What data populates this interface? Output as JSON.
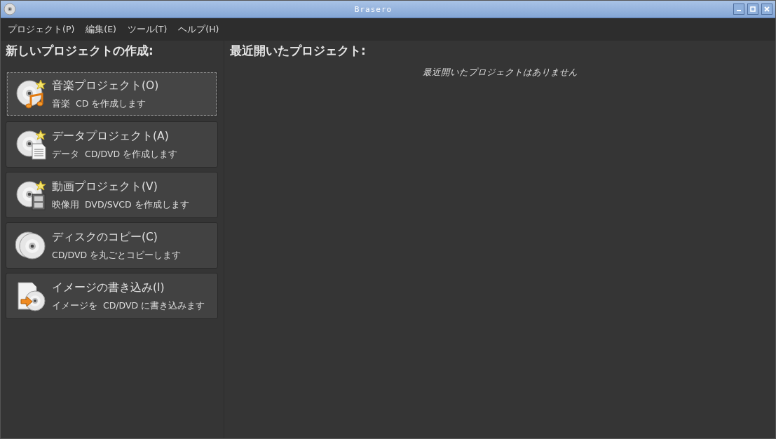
{
  "window": {
    "title": "Brasero"
  },
  "menu": [
    "プロジェクト(P)",
    "編集(E)",
    "ツール(T)",
    "ヘルプ(H)"
  ],
  "new_project": {
    "heading": "新しいプロジェクトの作成:",
    "items": [
      {
        "kind": "audio",
        "title": "音楽プロジェクト(O)",
        "description": "音楽  CD を作成します",
        "selected": true
      },
      {
        "kind": "data",
        "title": "データプロジェクト(A)",
        "description": "データ  CD/DVD を作成します",
        "selected": false
      },
      {
        "kind": "video",
        "title": "動画プロジェクト(V)",
        "description": "映像用  DVD/SVCD を作成します",
        "selected": false
      },
      {
        "kind": "copy",
        "title": "ディスクのコピー(C)",
        "description": "CD/DVD を丸ごとコピーします",
        "selected": false
      },
      {
        "kind": "image",
        "title": "イメージの書き込み(I)",
        "description": "イメージを  CD/DVD に書き込みます",
        "selected": false
      }
    ]
  },
  "recent": {
    "heading": "最近開いたプロジェクト:",
    "empty_message": "最近開いたプロジェクトはありません"
  }
}
